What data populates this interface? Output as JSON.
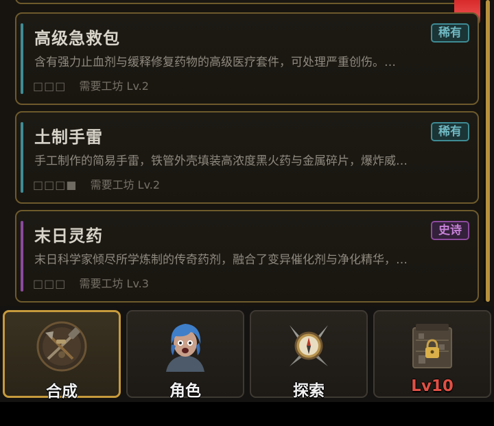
{
  "items": [
    {
      "name": "高级急救包",
      "rarity": "稀有",
      "rarity_type": "rare",
      "accent_color": "#3f8c95",
      "description": "含有强力止血剂与缓释修复药物的高级医疗套件，可处理严重创伤。…",
      "ingredients": "□□□",
      "requirement": "需要工坊 Lv.2"
    },
    {
      "name": "土制手雷",
      "rarity": "稀有",
      "rarity_type": "rare",
      "accent_color": "#3f8c95",
      "description": "手工制作的简易手雷，铁管外壳填装高浓度黑火药与金属碎片，爆炸威…",
      "ingredients": "□□□■",
      "requirement": "需要工坊 Lv.2"
    },
    {
      "name": "末日灵药",
      "rarity": "史诗",
      "rarity_type": "epic",
      "accent_color": "#8c4a9e",
      "description": "末日科学家倾尽所学炼制的传奇药剂，融合了变异催化剂与净化精华，…",
      "ingredients": "□□□",
      "requirement": "需要工坊 Lv.3"
    }
  ],
  "nav": {
    "tabs": [
      {
        "label": "合成",
        "icon": "crafting-tools-icon",
        "active": true
      },
      {
        "label": "角色",
        "icon": "survivor-portrait-icon",
        "active": false
      },
      {
        "label": "探索",
        "icon": "compass-knives-icon",
        "active": false
      },
      {
        "label": "Lv10",
        "icon": "locked-shop-icon",
        "active": false,
        "locked": true
      }
    ]
  },
  "colors": {
    "card_border": "#6e5a2c",
    "active_tab_border": "#c79b3c",
    "rare": "#6fb8c2",
    "epic": "#c782d8",
    "locked_label": "#e05045",
    "scrollbar": "#b8913e"
  }
}
